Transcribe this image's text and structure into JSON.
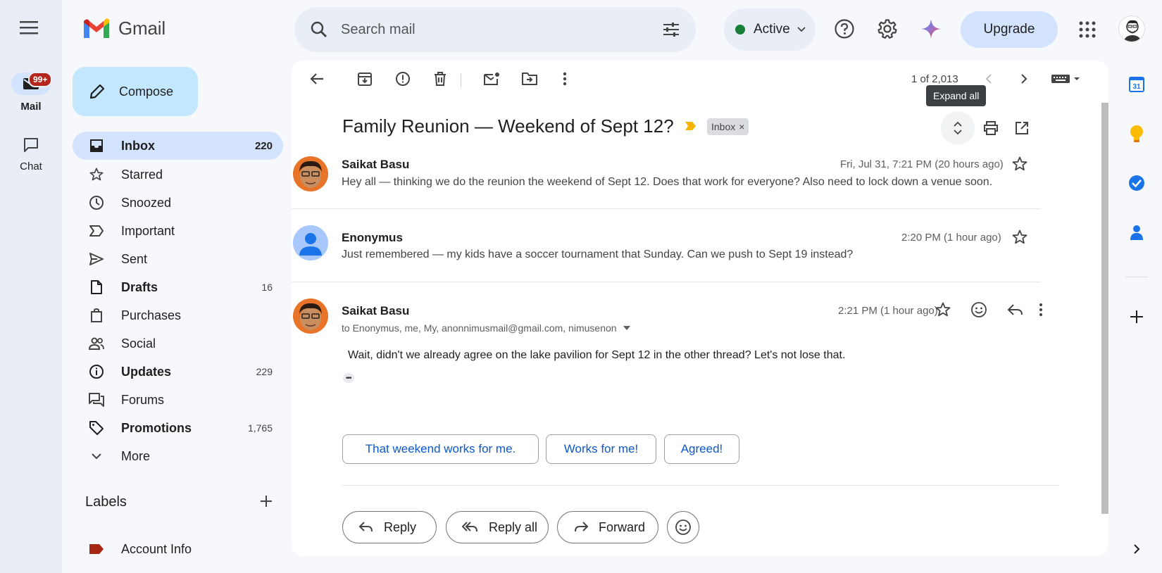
{
  "app": {
    "name": "Gmail"
  },
  "rail": {
    "mail_label": "Mail",
    "mail_badge": "99+",
    "chat_label": "Chat"
  },
  "sidebar": {
    "compose_label": "Compose",
    "items": [
      {
        "label": "Inbox",
        "count": "220"
      },
      {
        "label": "Starred",
        "count": ""
      },
      {
        "label": "Snoozed",
        "count": ""
      },
      {
        "label": "Important",
        "count": ""
      },
      {
        "label": "Sent",
        "count": ""
      },
      {
        "label": "Drafts",
        "count": "16"
      },
      {
        "label": "Purchases",
        "count": ""
      },
      {
        "label": "Social",
        "count": ""
      },
      {
        "label": "Updates",
        "count": "229"
      },
      {
        "label": "Forums",
        "count": ""
      },
      {
        "label": "Promotions",
        "count": "1,765"
      },
      {
        "label": "More",
        "count": ""
      }
    ],
    "labels_heading": "Labels",
    "labels": [
      {
        "label": "Account Info",
        "color": "#a52714"
      }
    ]
  },
  "topbar": {
    "search_placeholder": "Search mail",
    "status_label": "Active",
    "status_color": "#188038",
    "upgrade_label": "Upgrade"
  },
  "toolbar": {
    "pagination": "1 of 2,013",
    "tooltip": "Expand all"
  },
  "thread": {
    "subject": "Family Reunion — Weekend of Sept 12?",
    "label_chip": "Inbox",
    "label_chip_close": "×",
    "messages": [
      {
        "sender": "Saikat Basu",
        "snippet": "Hey all — thinking we do the reunion the weekend of Sept 12. Does that work for everyone? Also need to lock down a venue soon.",
        "time": "Fri, Jul 31, 7:21 PM (20 hours ago)"
      },
      {
        "sender": "Enonymus",
        "snippet": "Just remembered — my kids have a soccer tournament that Sunday. Can we push to Sept 19 instead?",
        "time": "2:20 PM (1 hour ago)"
      },
      {
        "sender": "Saikat Basu",
        "recipients": "to Enonymus, me, My, anonnimusmail@gmail.com, nimusenon",
        "body": "Wait, didn't we already agree on the lake pavilion for Sept 12 in the other thread? Let's not lose that.",
        "time": "2:21 PM (1 hour ago)",
        "ellipsis": "•••"
      }
    ],
    "smart_replies": [
      "That weekend works for me.",
      "Works for me!",
      "Agreed!"
    ],
    "actions": {
      "reply": "Reply",
      "reply_all": "Reply all",
      "forward": "Forward"
    }
  },
  "right_rail": {
    "calendar_day": "31"
  }
}
